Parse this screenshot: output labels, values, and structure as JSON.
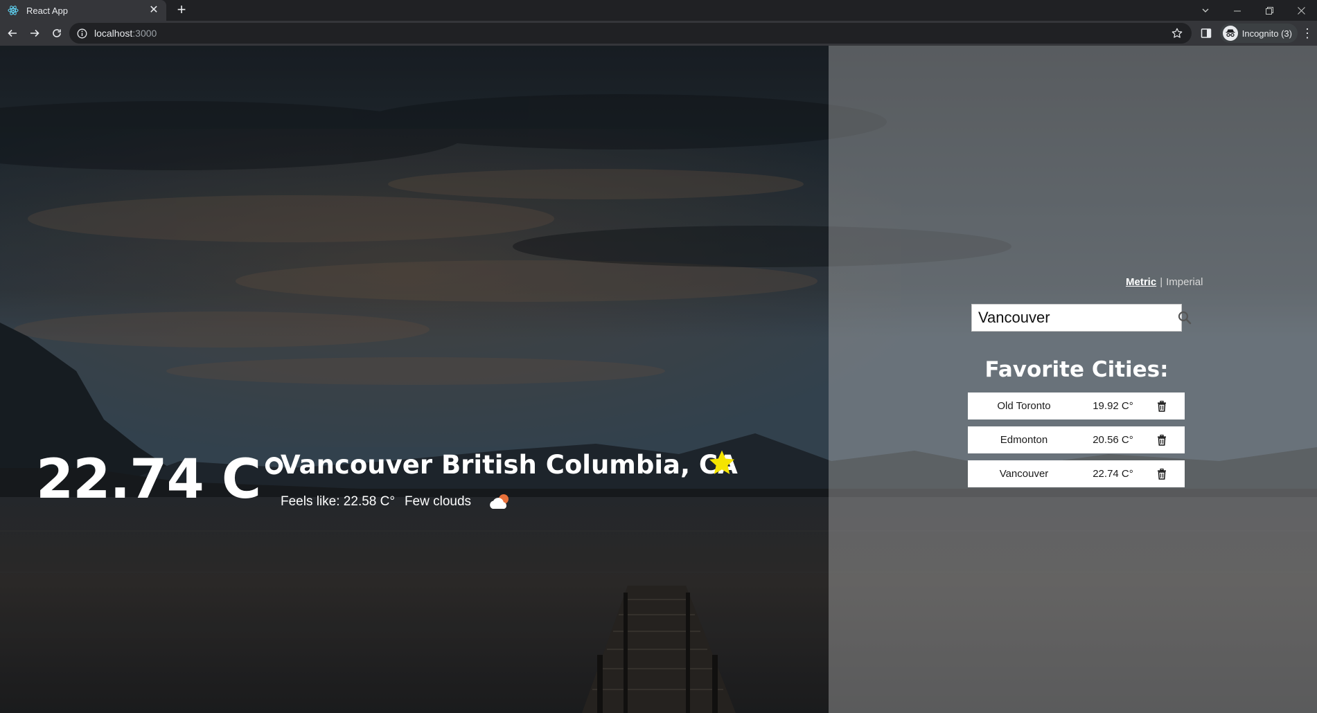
{
  "browser": {
    "tab_title": "React App",
    "url_host": "localhost",
    "url_port": ":3000",
    "profile_label": "Incognito (3)"
  },
  "weather": {
    "temperature": "22.74 C°",
    "location": "Vancouver British Columbia, CA",
    "feels_like": "Feels like: 22.58 C°",
    "description": "Few clouds",
    "icon": "few-clouds-icon"
  },
  "units": {
    "metric_label": "Metric",
    "separator": "|",
    "imperial_label": "Imperial",
    "selected": "metric"
  },
  "search": {
    "value": "Vancouver",
    "placeholder": ""
  },
  "favorites": {
    "title": "Favorite Cities:",
    "items": [
      {
        "name": "Old Toronto",
        "temp": "19.92 C°"
      },
      {
        "name": "Edmonton",
        "temp": "20.56 C°"
      },
      {
        "name": "Vancouver",
        "temp": "22.74 C°"
      }
    ]
  },
  "colors": {
    "star": "#f5e400",
    "cloud_sun": "#e8703a"
  }
}
